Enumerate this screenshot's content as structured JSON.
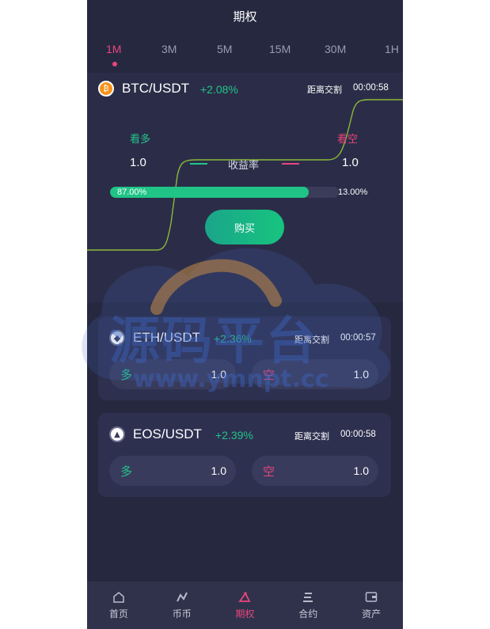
{
  "header": {
    "title": "期权"
  },
  "tabs": [
    {
      "label": "1M",
      "active": true
    },
    {
      "label": "3M"
    },
    {
      "label": "5M"
    },
    {
      "label": "15M"
    },
    {
      "label": "30M"
    },
    {
      "label": "1H"
    }
  ],
  "hero": {
    "pair": "BTC/USDT",
    "change": "+2.08%",
    "countdown_label": "距离交割",
    "countdown": "00:00:58",
    "long_label": "看多",
    "short_label": "看空",
    "long_value": "1.0",
    "short_value": "1.0",
    "yield_label": "收益率",
    "long_pct_text": "87.00%",
    "short_pct_text": "13.00%",
    "long_fraction": 0.87,
    "buy_label": "购买"
  },
  "cards": [
    {
      "pair": "ETH/USDT",
      "change": "+2.36%",
      "countdown_label": "距离交割",
      "countdown": "00:00:57",
      "long_label": "多",
      "short_label": "空",
      "long_value": "1.0",
      "short_value": "1.0"
    },
    {
      "pair": "EOS/USDT",
      "change": "+2.39%",
      "countdown_label": "距离交割",
      "countdown": "00:00:58",
      "long_label": "多",
      "short_label": "空",
      "long_value": "1.0",
      "short_value": "1.0"
    }
  ],
  "nav": [
    {
      "label": "首页",
      "icon": "home-icon"
    },
    {
      "label": "币币",
      "icon": "trend-icon"
    },
    {
      "label": "期权",
      "icon": "option-icon",
      "active": true
    },
    {
      "label": "合约",
      "icon": "contract-icon"
    },
    {
      "label": "资产",
      "icon": "wallet-icon"
    }
  ],
  "watermark": {
    "title": "源码平台",
    "url": "www.ymnpt.cc"
  },
  "colors": {
    "accent": "#e8457d",
    "up": "#22c48a",
    "bg": "#262840"
  }
}
